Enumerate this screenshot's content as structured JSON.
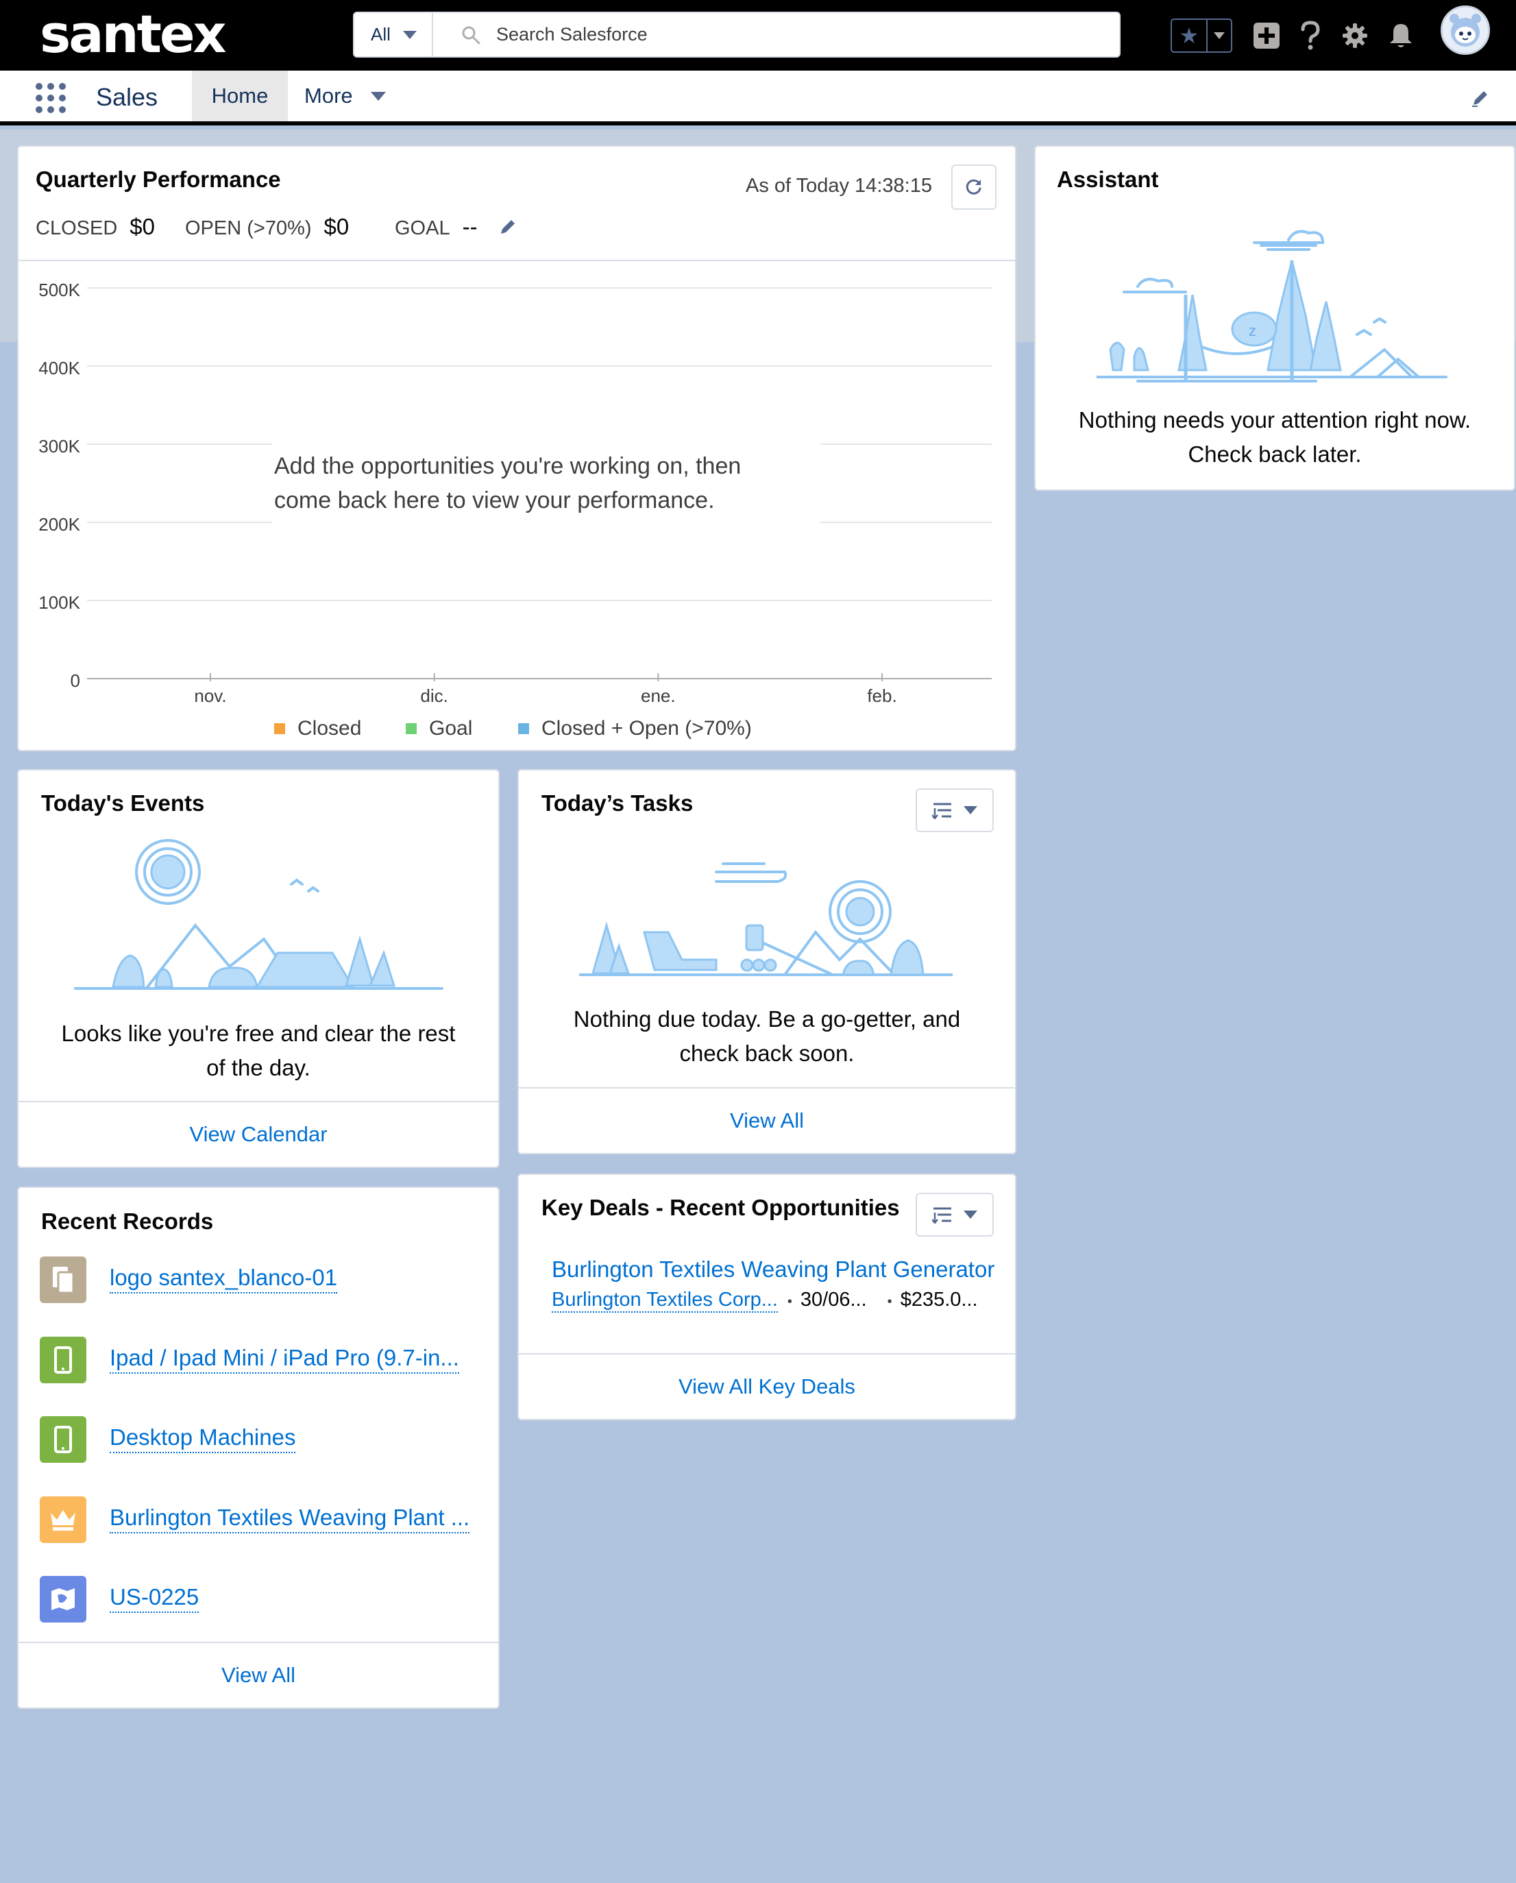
{
  "header": {
    "brand": "santex",
    "search_scope": "All",
    "search_placeholder": "Search Salesforce"
  },
  "nav": {
    "app_name": "Sales",
    "tabs": [
      {
        "label": "Home",
        "active": true
      },
      {
        "label": "More"
      }
    ]
  },
  "quarterly_performance": {
    "title": "Quarterly Performance",
    "as_of": "As of Today 14:38:15",
    "closed_label": "CLOSED",
    "closed_value": "$0",
    "open_label": "OPEN (>70%)",
    "open_value": "$0",
    "goal_label": "GOAL",
    "goal_value": "--",
    "empty_message_line1": "Add the opportunities you're working on, then",
    "empty_message_line2": "come back here to view your performance."
  },
  "chart_data": {
    "type": "line",
    "title": "",
    "xlabel": "",
    "ylabel": "",
    "categories": [
      "nov.",
      "dic.",
      "ene.",
      "feb."
    ],
    "y_ticks": [
      "500K",
      "400K",
      "300K",
      "200K",
      "100K",
      "0"
    ],
    "ylim": [
      0,
      500000
    ],
    "grid": true,
    "series": [
      {
        "name": "Closed",
        "color": "#f4a23a",
        "values": []
      },
      {
        "name": "Goal",
        "color": "#6fd074",
        "values": []
      },
      {
        "name": "Closed + Open (>70%)",
        "color": "#6bb3e2",
        "values": []
      }
    ],
    "legend_position": "bottom"
  },
  "assistant": {
    "title": "Assistant",
    "message_line1": "Nothing needs your attention right now.",
    "message_line2": "Check back later."
  },
  "todays_events": {
    "title": "Today's Events",
    "message_line1": "Looks like you're free and clear the rest",
    "message_line2": "of the day.",
    "footer_link": "View Calendar"
  },
  "todays_tasks": {
    "title": "Today’s Tasks",
    "message_line1": "Nothing due today. Be a go-getter, and",
    "message_line2": "check back soon.",
    "footer_link": "View All"
  },
  "recent_records": {
    "title": "Recent Records",
    "items": [
      {
        "label": "logo santex_blanco-01",
        "icon": "file-icon",
        "color": "#baac93"
      },
      {
        "label": "Ipad / Ipad Mini / iPad Pro (9.7-in...",
        "icon": "device-icon",
        "color": "#7cb342"
      },
      {
        "label": "Desktop Machines",
        "icon": "device-icon",
        "color": "#7cb342"
      },
      {
        "label": "Burlington Textiles Weaving Plant ...",
        "icon": "opportunity-crown-icon",
        "color": "#fcb95b"
      },
      {
        "label": "US-0225",
        "icon": "territory-map-icon",
        "color": "#6a89e5"
      }
    ],
    "footer_link": "View All"
  },
  "key_deals": {
    "title": "Key Deals - Recent Opportunities",
    "deals": [
      {
        "name": "Burlington Textiles Weaving Plant Generator",
        "account": "Burlington Textiles Corp...",
        "close_date": "30/06...",
        "amount": "$235.0..."
      }
    ],
    "footer_link": "View All Key Deals"
  },
  "colors": {
    "link": "#0070d2",
    "page_background": "#b0c4df",
    "header_background": "#000000"
  }
}
